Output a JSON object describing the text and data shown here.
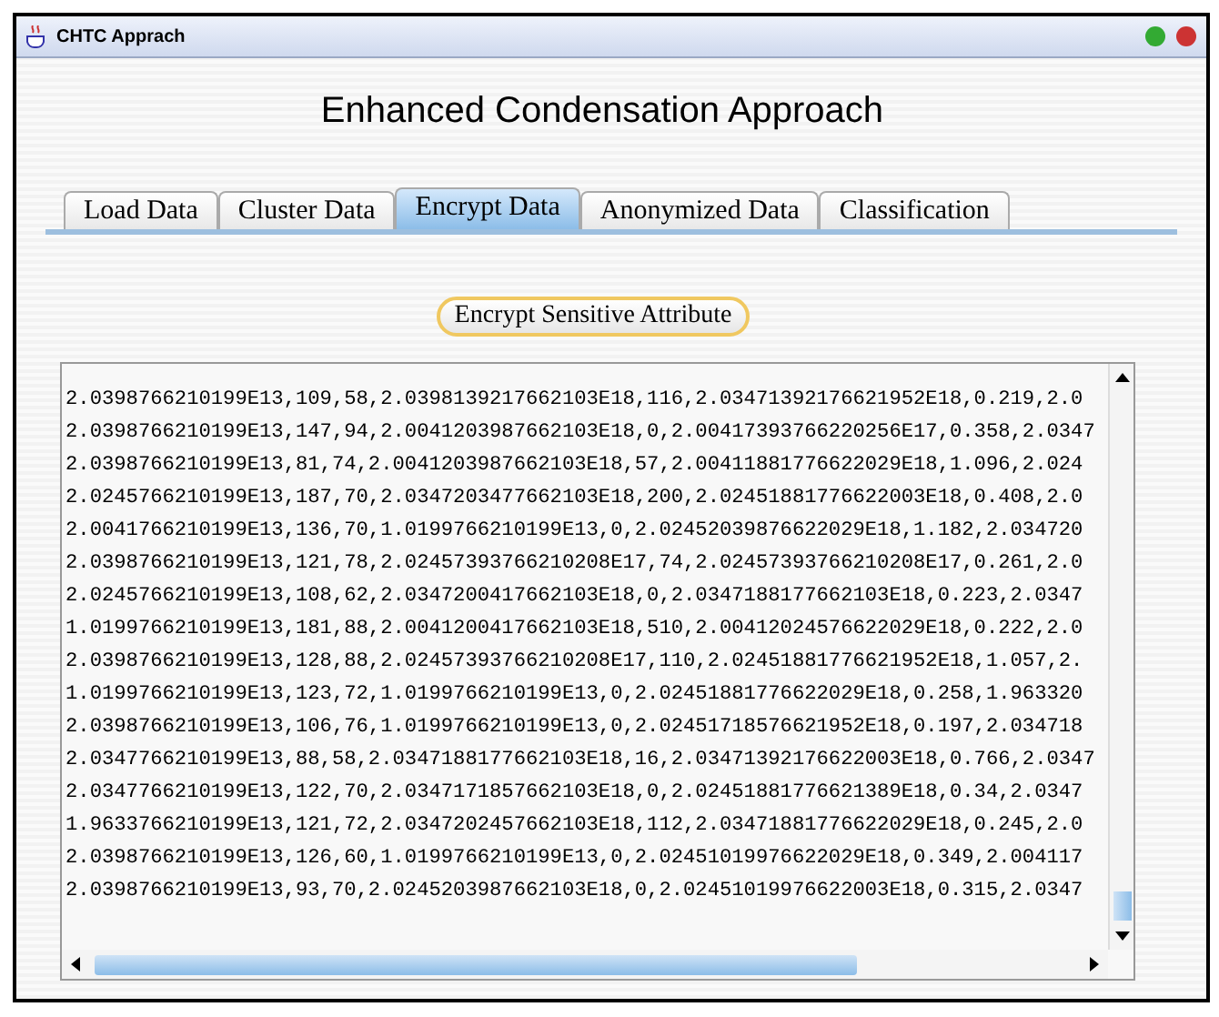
{
  "window": {
    "title": "CHTC Apprach"
  },
  "heading": "Enhanced Condensation Approach",
  "tabs": [
    {
      "label": "Load Data",
      "selected": false
    },
    {
      "label": "Cluster Data",
      "selected": false
    },
    {
      "label": "Encrypt Data",
      "selected": true
    },
    {
      "label": "Anonymized Data",
      "selected": false
    },
    {
      "label": "Classification",
      "selected": false
    }
  ],
  "action_button": "Encrypt Sensitive Attribute",
  "output_lines": [
    "2.0398766210199E13,109,58,2.0398139217662103E18,116,2.03471392176621952E18,0.219,2.0",
    "2.0398766210199E13,147,94,2.0041203987662103E18,0,2.00417393766220256E17,0.358,2.0347",
    "2.0398766210199E13,81,74,2.0041203987662103E18,57,2.00411881776622029E18,1.096,2.024",
    "2.0245766210199E13,187,70,2.0347203477662103E18,200,2.02451881776622003E18,0.408,2.0",
    "2.0041766210199E13,136,70,1.0199766210199E13,0,2.02452039876622029E18,1.182,2.034720",
    "2.0398766210199E13,121,78,2.02457393766210208E17,74,2.02457393766210208E17,0.261,2.0",
    "2.0245766210199E13,108,62,2.0347200417662103E18,0,2.0347188177662103E18,0.223,2.0347",
    "1.0199766210199E13,181,88,2.0041200417662103E18,510,2.00412024576622029E18,0.222,2.0",
    "2.0398766210199E13,128,88,2.02457393766210208E17,110,2.02451881776621952E18,1.057,2.",
    "1.0199766210199E13,123,72,1.0199766210199E13,0,2.02451881776622029E18,0.258,1.963320",
    "2.0398766210199E13,106,76,1.0199766210199E13,0,2.02451718576621952E18,0.197,2.034718",
    "2.0347766210199E13,88,58,2.0347188177662103E18,16,2.03471392176622003E18,0.766,2.0347",
    "2.0347766210199E13,122,70,2.0347171857662103E18,0,2.02451881776621389E18,0.34,2.0347",
    "1.9633766210199E13,121,72,2.0347202457662103E18,112,2.03471881776622029E18,0.245,2.0",
    "2.0398766210199E13,126,60,1.0199766210199E13,0,2.02451019976622029E18,0.349,2.004117",
    "2.0398766210199E13,93,70,2.0245203987662103E18,0,2.02451019976622003E18,0.315,2.0347"
  ]
}
